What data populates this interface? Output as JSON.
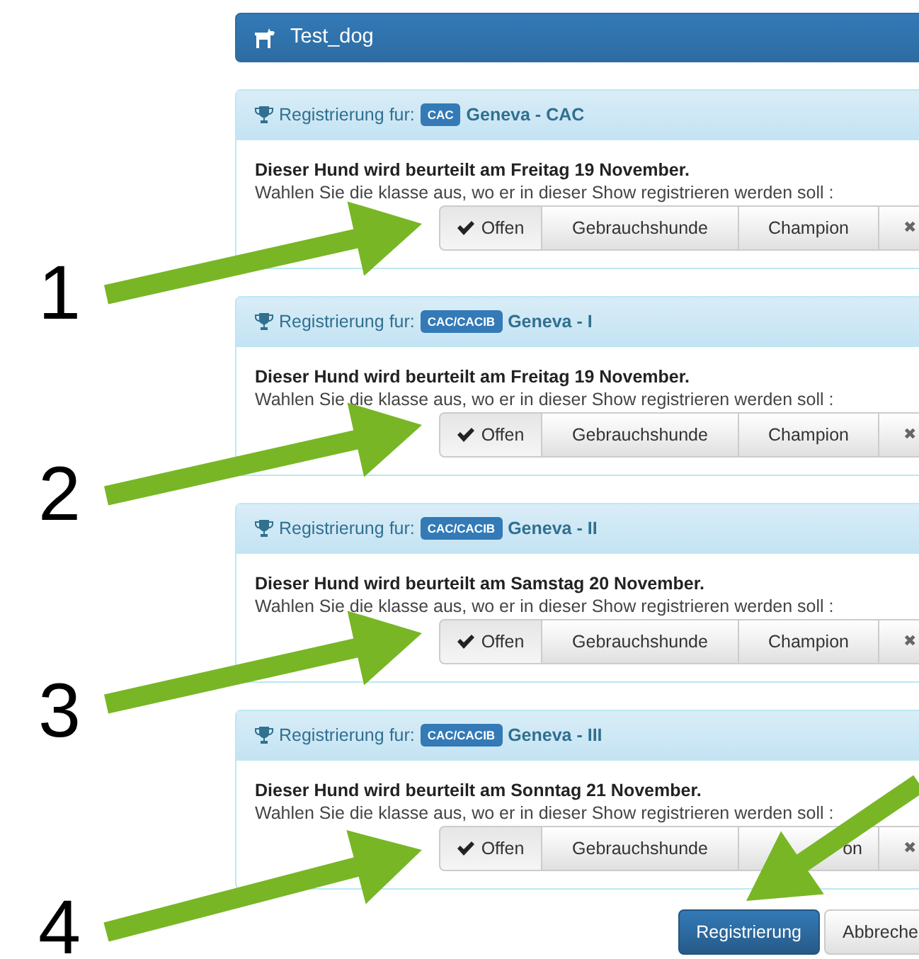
{
  "header": {
    "title": "Test_dog"
  },
  "registrations": [
    {
      "prefix": "Registrierung fur:",
      "badge": "CAC",
      "show": "Geneva - CAC",
      "date_line": "Dieser Hund wird beurteilt am Freitag 19 November.",
      "prompt": "Wahlen Sie die klasse aus, wo er in dieser Show registrieren werden soll :",
      "classes": [
        {
          "label": "Offen",
          "selected": true
        },
        {
          "label": "Gebrauchshunde",
          "selected": false
        },
        {
          "label": "Champion",
          "selected": false
        }
      ],
      "clear_button": "✖"
    },
    {
      "prefix": "Registrierung fur:",
      "badge": "CAC/CACIB",
      "show": "Geneva - I",
      "date_line": "Dieser Hund wird beurteilt am Freitag 19 November.",
      "prompt": "Wahlen Sie die klasse aus, wo er in dieser Show registrieren werden soll :",
      "classes": [
        {
          "label": "Offen",
          "selected": true
        },
        {
          "label": "Gebrauchshunde",
          "selected": false
        },
        {
          "label": "Champion",
          "selected": false
        }
      ],
      "clear_button": "✖"
    },
    {
      "prefix": "Registrierung fur:",
      "badge": "CAC/CACIB",
      "show": "Geneva - II",
      "date_line": "Dieser Hund wird beurteilt am Samstag 20 November.",
      "prompt": "Wahlen Sie die klasse aus, wo er in dieser Show registrieren werden soll :",
      "classes": [
        {
          "label": "Offen",
          "selected": true
        },
        {
          "label": "Gebrauchshunde",
          "selected": false
        },
        {
          "label": "Champion",
          "selected": false
        }
      ],
      "clear_button": "✖"
    },
    {
      "prefix": "Registrierung fur:",
      "badge": "CAC/CACIB",
      "show": "Geneva - III",
      "date_line": "Dieser Hund wird beurteilt am Sonntag 21 November.",
      "prompt": "Wahlen Sie die klasse aus, wo er in dieser Show registrieren werden soll :",
      "classes": [
        {
          "label": "Offen",
          "selected": true
        },
        {
          "label": "Gebrauchshunde",
          "selected": false
        },
        {
          "label": "on",
          "selected": false,
          "kind": "covered"
        }
      ],
      "clear_button": "✖"
    }
  ],
  "buttons": [
    {
      "label": "Registrierung",
      "kind": "primary"
    },
    {
      "label": "Abbreche",
      "kind": "default"
    }
  ],
  "callouts": [
    {
      "kind": "numbered",
      "label": "1"
    },
    {
      "kind": "numbered",
      "label": "2"
    },
    {
      "kind": "numbered",
      "label": "3"
    },
    {
      "kind": "numbered",
      "label": "4"
    },
    {
      "kind": "arrow"
    }
  ]
}
